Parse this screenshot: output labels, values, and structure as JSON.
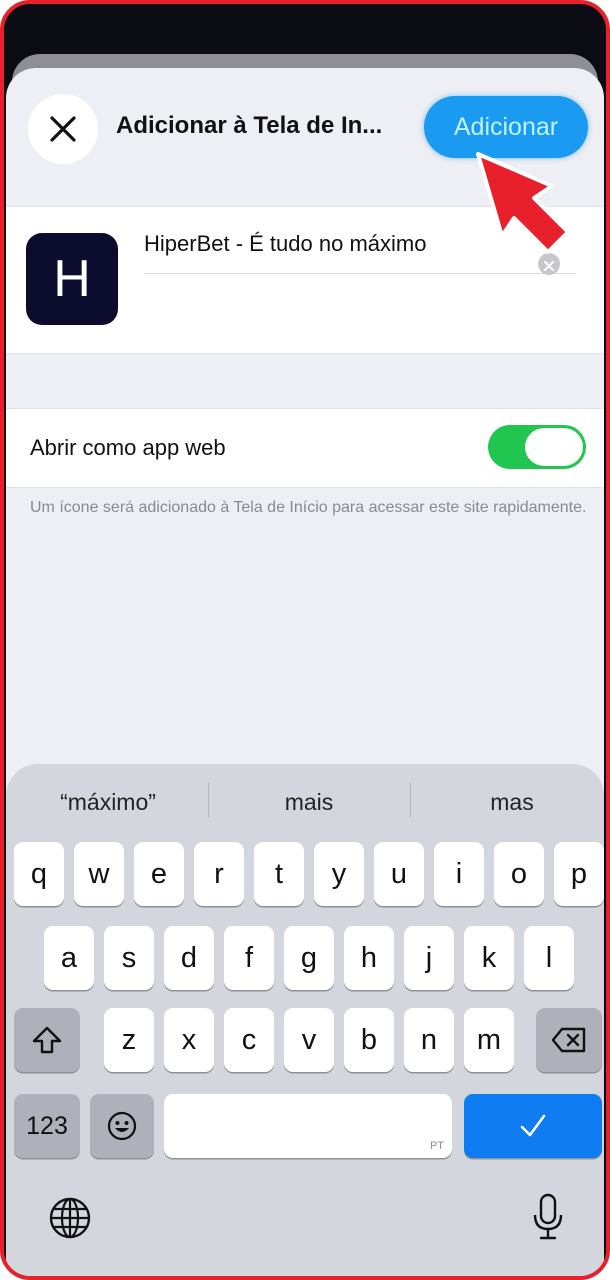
{
  "sheet": {
    "title": "Adicionar à Tela de In...",
    "add_label": "Adicionar",
    "close_icon": "close-icon"
  },
  "app": {
    "icon_letter": "H",
    "icon_color": "#0c0c2e",
    "name_value": "HiperBet - É tudo no máximo"
  },
  "webapp": {
    "toggle_label": "Abrir como app web",
    "toggle_on": true,
    "toggle_color": "#20c64f",
    "footnote": "Um ícone será adicionado à Tela de Início para acessar este site rapidamente."
  },
  "keyboard": {
    "suggestions": [
      "“máximo”",
      "mais",
      "mas"
    ],
    "row1": [
      "q",
      "w",
      "e",
      "r",
      "t",
      "y",
      "u",
      "i",
      "o",
      "p"
    ],
    "row2": [
      "a",
      "s",
      "d",
      "f",
      "g",
      "h",
      "j",
      "k",
      "l"
    ],
    "row3": [
      "z",
      "x",
      "c",
      "v",
      "b",
      "n",
      "m"
    ],
    "numbers_label": "123",
    "space_language": "PT",
    "accent_color": "#0f7cf2"
  },
  "annotation": {
    "arrow_color": "#e8202b"
  }
}
